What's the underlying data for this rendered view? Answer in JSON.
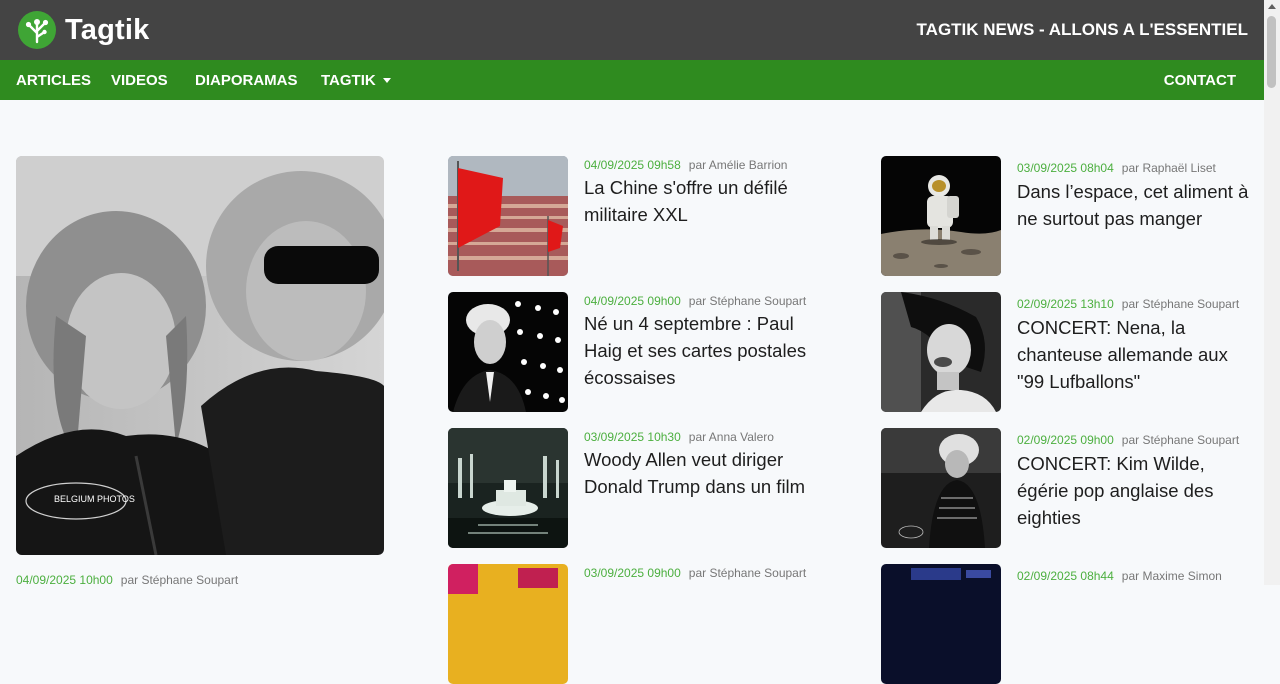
{
  "header": {
    "logo_text": "Tagtik",
    "tagline": "TAGTIK NEWS - ALLONS A L'ESSENTIEL"
  },
  "nav": {
    "articles": "ARTICLES",
    "videos": "VIDEOS",
    "diaporamas": "DIAPORAMAS",
    "tagtik": "TAGTIK",
    "contact": "CONTACT"
  },
  "featured": {
    "date": "04/09/2025 10h00",
    "author": "par Stéphane Soupart",
    "watermark": "BELGIUM PHOTOS"
  },
  "middle_column": [
    {
      "date": "04/09/2025 09h58",
      "author": "par Amélie Barrion",
      "title": "La Chine s'offre un défilé militaire XXL"
    },
    {
      "date": "04/09/2025 09h00",
      "author": "par Stéphane Soupart",
      "title": "Né un 4 septembre : Paul Haig et ses cartes postales écossaises"
    },
    {
      "date": "03/09/2025 10h30",
      "author": "par Anna Valero",
      "title": "Woody Allen veut diriger Donald Trump dans un film"
    },
    {
      "date": "03/09/2025 09h00",
      "author": "par Stéphane Soupart",
      "title": ""
    }
  ],
  "right_column": [
    {
      "date": "03/09/2025 08h04",
      "author": "par Raphaël Liset",
      "title": "Dans l’espace, cet aliment à ne surtout pas manger"
    },
    {
      "date": "02/09/2025 13h10",
      "author": "par Stéphane Soupart",
      "title": "CONCERT: Nena, la chanteuse allemande aux \"99 Lufballons\""
    },
    {
      "date": "02/09/2025 09h00",
      "author": "par Stéphane Soupart",
      "title": "CONCERT: Kim Wilde, égérie pop anglaise des eighties"
    },
    {
      "date": "02/09/2025 08h44",
      "author": "par Maxime Simon",
      "title": ""
    }
  ],
  "colors": {
    "header_bg": "#444444",
    "nav_bg": "#2f8b1f",
    "date_green": "#4caf3f",
    "logo_green": "#3fa535"
  }
}
